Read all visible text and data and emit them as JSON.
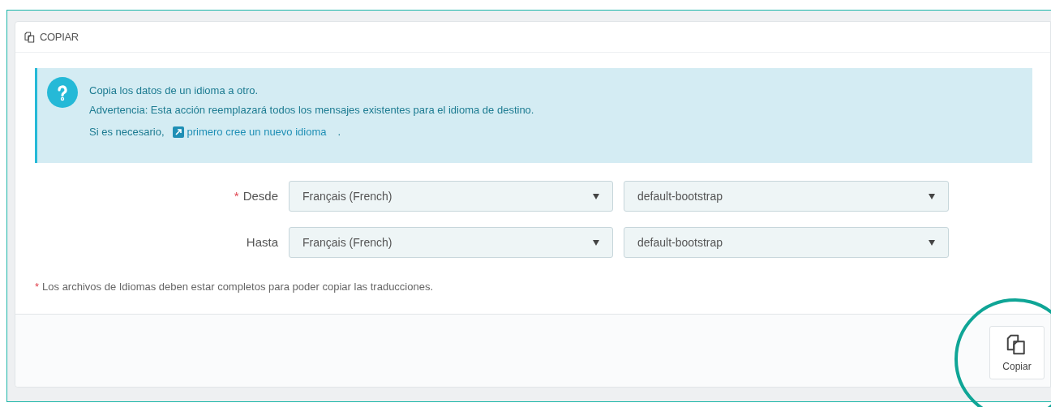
{
  "panel": {
    "title": "COPIAR"
  },
  "info": {
    "lines": [
      "Copia los datos de un idioma a otro.",
      "Advertencia: Esta acción reemplazará todos los mensajes existentes para el idioma de destino."
    ],
    "link_prefix": "Si es necesario,",
    "link": "primero cree un nuevo idioma",
    "link_suffix": "."
  },
  "rows": [
    {
      "label": "Desde",
      "required": true,
      "language": "Français (French)",
      "theme": "default-bootstrap"
    },
    {
      "label": "Hasta",
      "required": false,
      "language": "Français (French)",
      "theme": "default-bootstrap"
    }
  ],
  "footnote": {
    "mark": "*",
    "text": "Los archivos de Idiomas deben estar completos para poder copiar las traducciones."
  },
  "footer": {
    "button": "Copiar",
    "highlighted": true
  }
}
